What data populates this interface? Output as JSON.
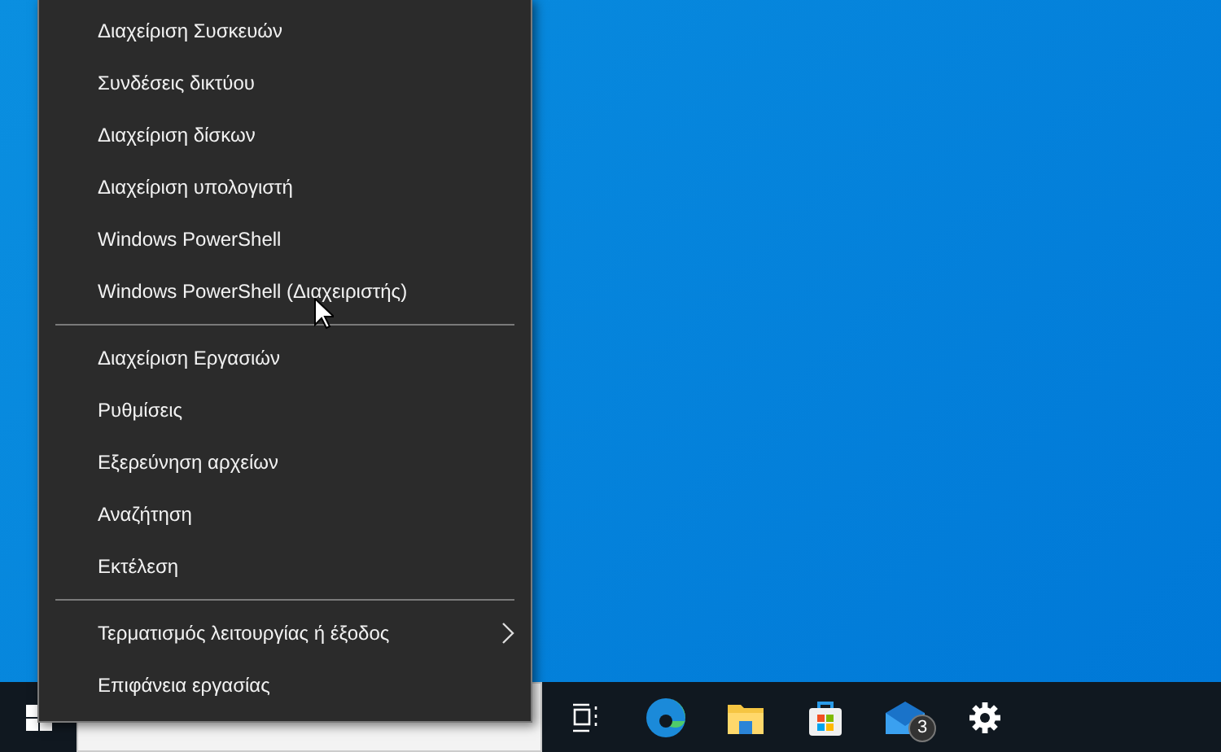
{
  "menu": {
    "groups": [
      {
        "items": [
          {
            "label": "Διαχείριση Συσκευών",
            "submenu": false
          },
          {
            "label": "Συνδέσεις δικτύου",
            "submenu": false
          },
          {
            "label": "Διαχείριση δίσκων",
            "submenu": false
          },
          {
            "label": "Διαχείριση υπολογιστή",
            "submenu": false
          },
          {
            "label": "Windows PowerShell",
            "submenu": false
          },
          {
            "label": "Windows PowerShell (Διαχειριστής)",
            "submenu": false
          }
        ]
      },
      {
        "items": [
          {
            "label": "Διαχείριση Εργασιών",
            "submenu": false
          },
          {
            "label": "Ρυθμίσεις",
            "submenu": false
          },
          {
            "label": "Εξερεύνηση αρχείων",
            "submenu": false
          },
          {
            "label": "Αναζήτηση",
            "submenu": false
          },
          {
            "label": "Εκτέλεση",
            "submenu": false
          }
        ]
      },
      {
        "items": [
          {
            "label": "Τερματισμός λειτουργίας ή έξοδος",
            "submenu": true
          },
          {
            "label": "Επιφάνεια εργασίας",
            "submenu": false
          }
        ]
      }
    ]
  },
  "taskbar": {
    "apps": [
      {
        "kind": "taskview"
      },
      {
        "kind": "browser"
      },
      {
        "kind": "folder"
      },
      {
        "kind": "store"
      },
      {
        "kind": "mail",
        "badge": "3"
      },
      {
        "kind": "settings"
      }
    ]
  }
}
